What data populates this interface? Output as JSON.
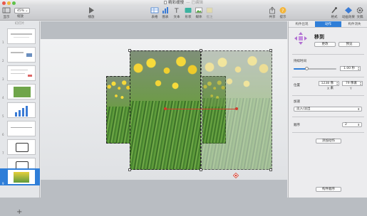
{
  "window": {
    "title": "精彩缓慢",
    "title_suffix": "— 已编辑"
  },
  "toolbar": {
    "view_label": "显示",
    "zoom_value": "45%",
    "zoom_label": "缩放",
    "play_label": "播放",
    "table_label": "表格",
    "chart_label": "图表",
    "text_label": "文本",
    "shape_label": "形状",
    "media_label": "媒体",
    "comment_label": "批注",
    "share_label": "共享",
    "tips_label": "提示",
    "format_label": "格式",
    "animate_label": "动画效果",
    "document_label": "文稿"
  },
  "navigator": {
    "header": "幻灯片",
    "slides": [
      {
        "num": "1"
      },
      {
        "num": "2"
      },
      {
        "num": "3"
      },
      {
        "num": "4"
      },
      {
        "num": "5"
      },
      {
        "num": "6"
      },
      {
        "num": "7"
      },
      {
        "num": "8"
      },
      {
        "num": "9"
      }
    ],
    "add_label": "+"
  },
  "inspector": {
    "tabs": [
      "构件出现",
      "动作",
      "构件消失"
    ],
    "animation_name": "移到",
    "change_button": "更改",
    "preview_button": "预览",
    "duration_label": "持续时间",
    "duration_value": "1.00 秒",
    "duration_fraction": 0.3,
    "position_label": "位置",
    "pos_x": "1238 像素",
    "pos_y": "79 像素",
    "x_label": "X",
    "y_label": "Y",
    "accel_label": "加速",
    "accel_value": "淡入/淡出",
    "order_label": "顺序",
    "order_value": "2",
    "add_action_button": "添加动作",
    "build_order_button": "构件顺序"
  },
  "colors": {
    "accent": "#2f7ed8",
    "motion_path": "#d23c2c"
  }
}
